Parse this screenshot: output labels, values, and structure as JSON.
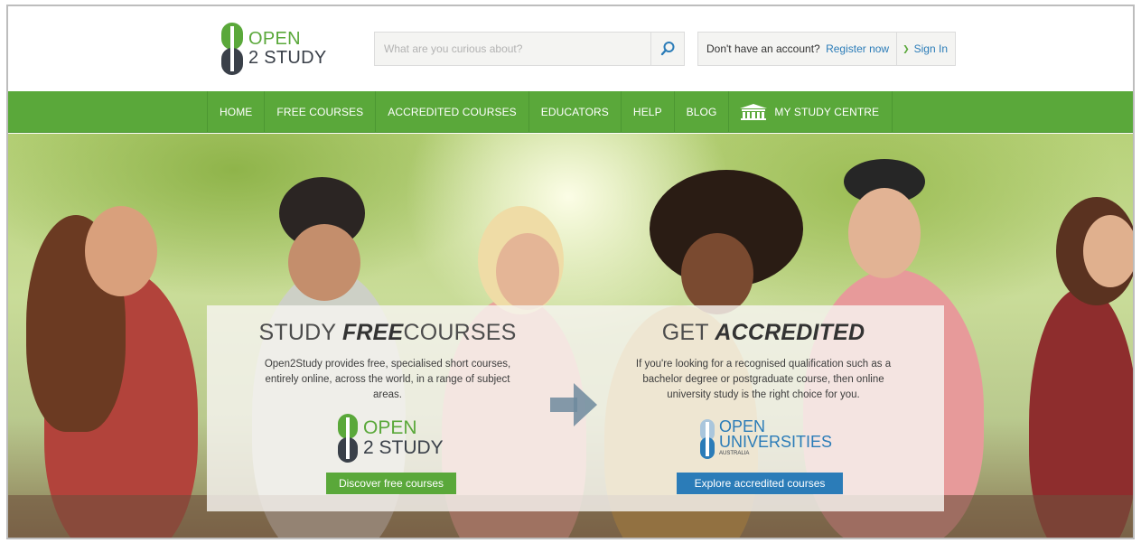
{
  "brand": {
    "logo_line1": "OPEN",
    "logo_line2": "2 STUDY",
    "logo_icon": "open2study-logo-icon",
    "green": "#5aa83a",
    "blue": "#2b7cb8"
  },
  "search": {
    "placeholder": "What are you curious about?",
    "icon": "search-icon"
  },
  "account": {
    "prompt": "Don't have an account?",
    "register_label": "Register now",
    "signin_label": "Sign In",
    "signin_icon": "chevron-down-icon"
  },
  "nav": {
    "items": [
      {
        "label": "HOME"
      },
      {
        "label": "FREE COURSES"
      },
      {
        "label": "ACCREDITED COURSES"
      },
      {
        "label": "EDUCATORS"
      },
      {
        "label": "HELP"
      },
      {
        "label": "BLOG"
      },
      {
        "label": "MY STUDY CENTRE",
        "icon": "building-icon"
      }
    ]
  },
  "hero": {
    "free": {
      "title_pre": "STUDY",
      "title_em": "FREE",
      "title_post": "COURSES",
      "text": "Open2Study provides free, specialised short courses, entirely online, across the world, in a range of subject areas.",
      "logo_line1": "OPEN",
      "logo_line2": "2 STUDY",
      "button_label": "Discover free courses"
    },
    "accredited": {
      "title_pre": "GET",
      "title_em": "ACCREDITED",
      "text": "If you're looking for a recognised qualification such as a bachelor degree or postgraduate course, then online university study is the right choice for you.",
      "logo_line1": "OPEN",
      "logo_line2": "UNIVERSITIES",
      "logo_line3": "AUSTRALIA",
      "button_label": "Explore accredited courses"
    },
    "arrow_icon": "arrow-right-icon"
  }
}
